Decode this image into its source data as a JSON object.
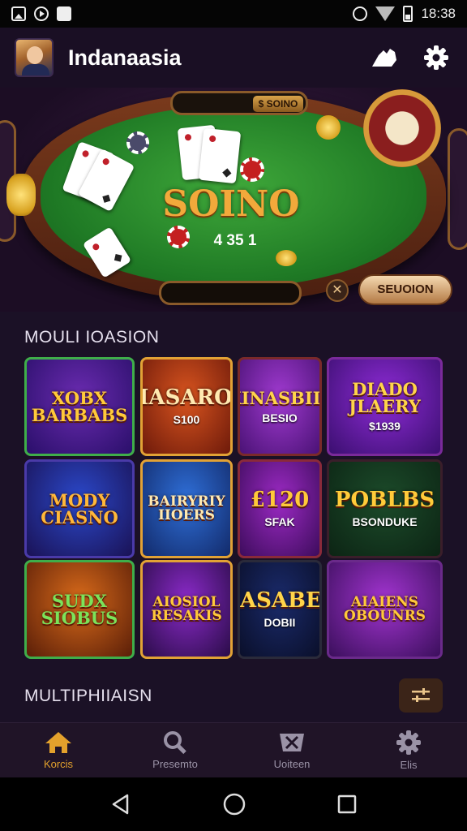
{
  "status_bar": {
    "time": "18:38",
    "left_icons": [
      "photo-icon",
      "play-icon",
      "image-icon"
    ],
    "right_icons": [
      "alarm-icon",
      "wifi-icon",
      "battery-icon"
    ]
  },
  "header": {
    "title": "Indanaasia",
    "icons": [
      "hand-icon",
      "gear-icon"
    ]
  },
  "hero": {
    "title": "SOINO",
    "subtitle": "4 35 1",
    "top_badge": "$ SOINO",
    "button_label": "SEUOION",
    "close_symbol": "✕"
  },
  "sections": {
    "games_title": "MOULI IOASION",
    "more_title": "MULTIPHIIAISN"
  },
  "games": [
    {
      "title": "XOBX BARBABS",
      "sub": "",
      "colors": [
        "#6a2bb0",
        "#2a0f6a"
      ],
      "border": "#3fae4a",
      "title_color": "#ffc93a"
    },
    {
      "title": "KIASAROH",
      "sub": "S100",
      "colors": [
        "#d8541f",
        "#6e1a0a"
      ],
      "border": "#e2a235",
      "title_color": "#ffe9b0"
    },
    {
      "title": "KINASBIIY",
      "sub": "BESIO",
      "colors": [
        "#a03ad0",
        "#4a1275"
      ],
      "border": "#7a2a2a",
      "title_color": "#ffd44a"
    },
    {
      "title": "DIADO JLAERY",
      "sub": "$1939",
      "colors": [
        "#8e2bd6",
        "#3b0f70"
      ],
      "border": "#7a2a9a",
      "title_color": "#ffd44a"
    },
    {
      "title": "MODY CIASNO",
      "sub": "",
      "colors": [
        "#2b48c9",
        "#1a1256"
      ],
      "border": "#4a3aa8",
      "title_color": "#ffb83a"
    },
    {
      "title": "BAIRYRIY IIOERS",
      "sub": "",
      "colors": [
        "#2f6fd8",
        "#122a6a"
      ],
      "border": "#e2a235",
      "title_color": "#ffe9b0"
    },
    {
      "title": "£120",
      "sub": "SFAK",
      "colors": [
        "#9c2ac4",
        "#3d0c5c"
      ],
      "border": "#8a2a3a",
      "title_color": "#ffc93a"
    },
    {
      "title": "POBLBS",
      "sub": "BSONDUKE",
      "colors": [
        "#1c4b2a",
        "#0c2414"
      ],
      "border": "#3a1e2a",
      "title_color": "#ffcb3a"
    },
    {
      "title": "SUDX SIOBUS",
      "sub": "",
      "colors": [
        "#d86a1a",
        "#5a1e08"
      ],
      "border": "#3fae4a",
      "title_color": "#7be35a"
    },
    {
      "title": "AIOSIOL RESAKIS",
      "sub": "",
      "colors": [
        "#8a2ac8",
        "#2a0c48"
      ],
      "border": "#e2a235",
      "title_color": "#ffc93a"
    },
    {
      "title": "KASABES",
      "sub": "DOBII",
      "colors": [
        "#1a2a6a",
        "#0a0f2a"
      ],
      "border": "#2a2a3a",
      "title_color": "#ffd44a"
    },
    {
      "title": "AIAIENS OBOUNRS",
      "sub": "",
      "colors": [
        "#a234d0",
        "#3b0f5c"
      ],
      "border": "#6a2a8a",
      "title_color": "#ffc93a"
    }
  ],
  "bottom_nav": [
    {
      "label": "Korcis",
      "icon": "home-icon",
      "active": true
    },
    {
      "label": "Presemto",
      "icon": "search-icon",
      "active": false
    },
    {
      "label": "Uoiteen",
      "icon": "ticket-icon",
      "active": false
    },
    {
      "label": "Elis",
      "icon": "gear-icon",
      "active": false
    }
  ],
  "system_nav": [
    "back-icon",
    "home-circle-icon",
    "recents-icon"
  ],
  "colors": {
    "accent": "#e3a12c",
    "background": "#1b1126",
    "header": "#1a0f24"
  }
}
